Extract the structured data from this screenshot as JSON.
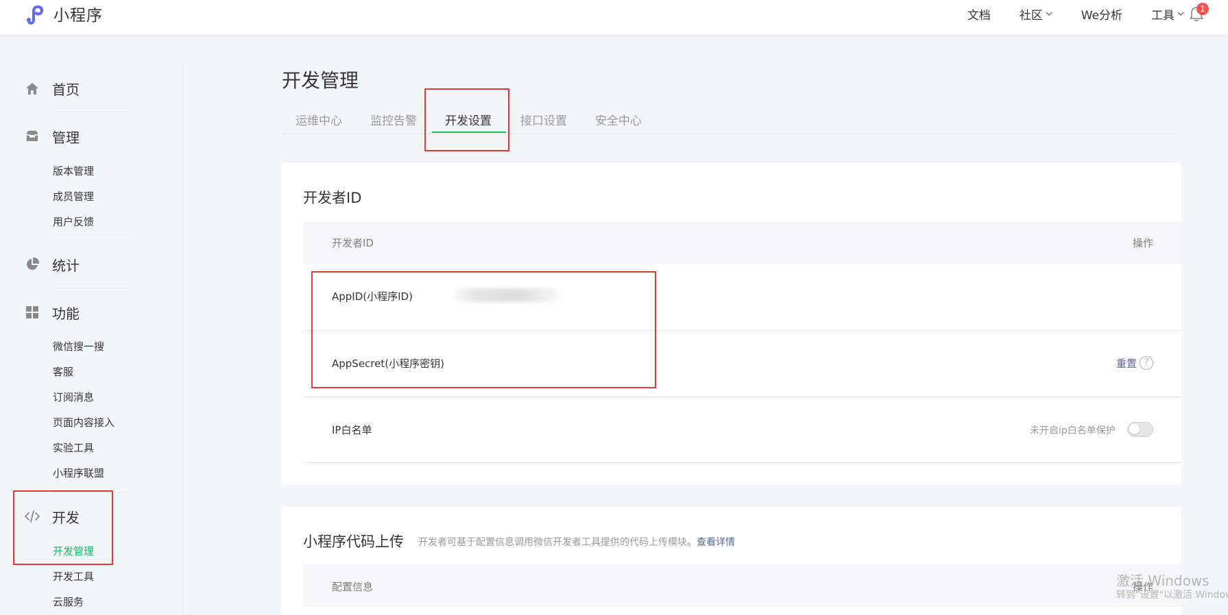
{
  "header": {
    "logo_text": "小程序",
    "nav": [
      {
        "label": "文档",
        "has_dropdown": false
      },
      {
        "label": "社区",
        "has_dropdown": true
      },
      {
        "label": "We分析",
        "has_dropdown": false
      },
      {
        "label": "工具",
        "has_dropdown": true
      }
    ],
    "notification_count": "1"
  },
  "sidebar": {
    "home": {
      "label": "首页",
      "icon": "home-icon"
    },
    "manage": {
      "label": "管理",
      "icon": "inbox-icon",
      "items": [
        "版本管理",
        "成员管理",
        "用户反馈"
      ]
    },
    "stats": {
      "label": "统计",
      "icon": "pie-chart-icon"
    },
    "features": {
      "label": "功能",
      "icon": "grid-icon",
      "items": [
        "微信搜一搜",
        "客服",
        "订阅消息",
        "页面内容接入",
        "实验工具",
        "小程序联盟"
      ]
    },
    "dev": {
      "label": "开发",
      "icon": "code-icon",
      "items": [
        "开发管理",
        "开发工具",
        "云服务"
      ],
      "active_item": "开发管理"
    }
  },
  "main": {
    "title": "开发管理",
    "tabs": [
      "运维中心",
      "监控告警",
      "开发设置",
      "接口设置",
      "安全中心"
    ],
    "active_tab": "开发设置",
    "developer_id": {
      "title": "开发者ID",
      "header_left": "开发者ID",
      "header_right": "操作",
      "rows": {
        "appid_label": "AppID(小程序ID)",
        "appsecret_label": "AppSecret(小程序密钥)",
        "appsecret_action": "重置",
        "ip_label": "IP白名单",
        "ip_status": "未开启ip白名单保护"
      }
    },
    "upload": {
      "title": "小程序代码上传",
      "desc": "开发者可基于配置信息调用微信开发者工具提供的代码上传模块。",
      "link": "查看详情",
      "header_left": "配置信息",
      "header_right": "操作"
    }
  },
  "watermark": {
    "line1": "激活 Windows",
    "line2": "转到\"设置\"以激活 Windows。"
  },
  "colors": {
    "accent": "#07c160",
    "link": "#576b95",
    "highlight_box": "#e53935",
    "badge": "#fa5151"
  }
}
